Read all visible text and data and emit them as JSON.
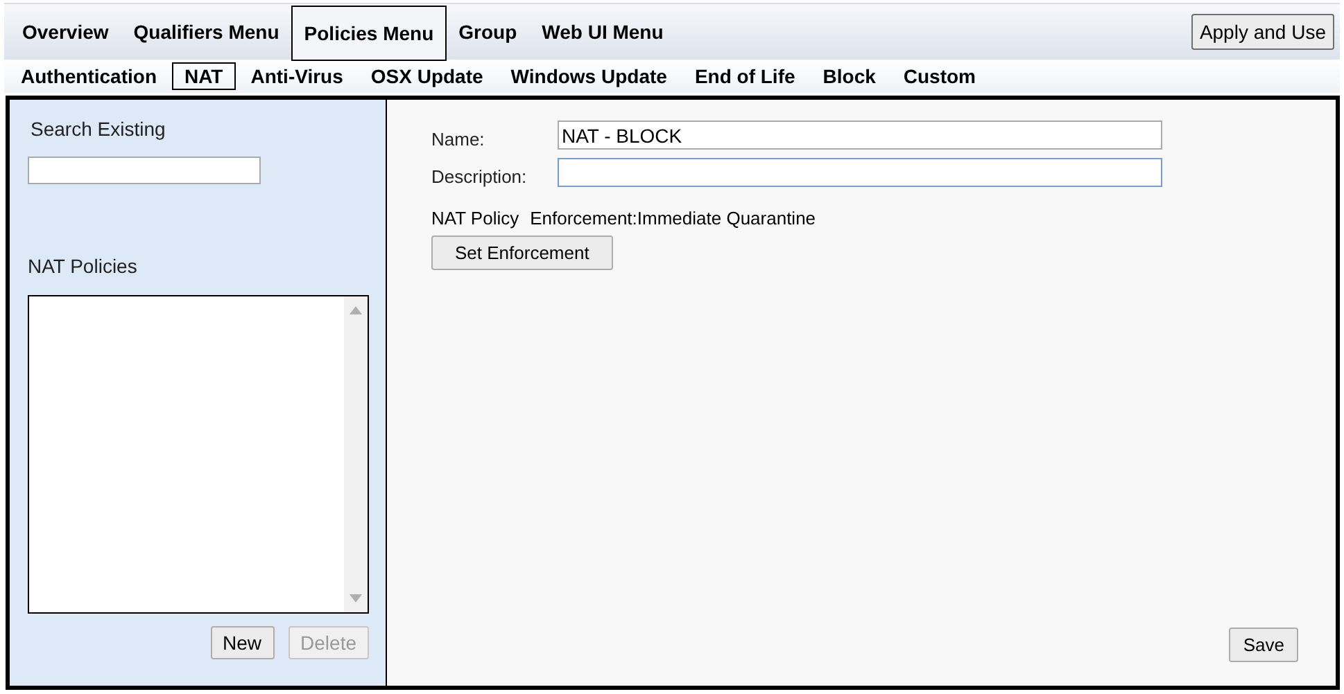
{
  "menu": [
    {
      "label": "Overview",
      "selected": false
    },
    {
      "label": "Qualifiers Menu",
      "selected": false
    },
    {
      "label": "Policies Menu",
      "selected": true
    },
    {
      "label": "Group",
      "selected": false
    },
    {
      "label": "Web UI Menu",
      "selected": false
    }
  ],
  "apply_button": "Apply and Use",
  "tabs": [
    {
      "label": "Authentication",
      "selected": false
    },
    {
      "label": "NAT",
      "selected": true
    },
    {
      "label": "Anti-Virus",
      "selected": false
    },
    {
      "label": "OSX Update",
      "selected": false
    },
    {
      "label": "Windows Update",
      "selected": false
    },
    {
      "label": "End of Life",
      "selected": false
    },
    {
      "label": "Block",
      "selected": false
    },
    {
      "label": "Custom",
      "selected": false
    }
  ],
  "sidebar": {
    "search_label": "Search Existing",
    "list_label": "NAT Policies",
    "buttons": [
      {
        "label": "New",
        "disabled": false
      },
      {
        "label": "Delete",
        "disabled": true
      }
    ]
  },
  "form": {
    "fields": [
      {
        "label": "Name:",
        "value": "NAT - BLOCK",
        "focused": false
      },
      {
        "label": "Description:",
        "focused": true
      }
    ],
    "policy_label": "NAT Policy",
    "enforcement": "Enforcement:Immediate Quarantine",
    "enforcement_button": "Set Enforcement",
    "save_button": "Save"
  }
}
